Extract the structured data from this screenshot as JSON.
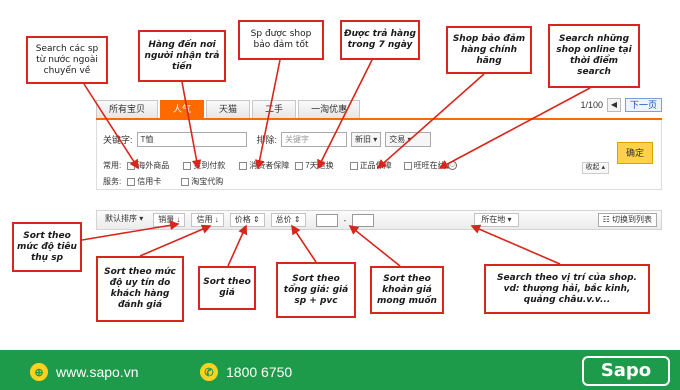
{
  "annotations": {
    "search_overseas": "Search các sp từ nước ngoài chuyển về",
    "cod": "Hàng đến nơi người nhận trả tiền",
    "guarantee": "Sp được shop bảo đảm tốt",
    "return7": "Được trả hàng trong 7 ngày",
    "authentic": "Shop bảo đảm hàng chính hãng",
    "online": "Search những shop online tại thời điểm search",
    "sort_volume": "Sort theo mức độ tiêu thụ sp",
    "sort_credit": "Sort theo mức độ uy tín do khách hàng đánh giá",
    "sort_price": "Sort theo giá",
    "sort_total": "Sort theo tổng giá: giá sp + pvc",
    "price_range": "Sort theo khoản giá mong muốn",
    "location": "Search theo vị trí của shop. vd: thượng hải, bắc kinh, quảng châu.v.v..."
  },
  "tabs": [
    "所有宝贝",
    "人气",
    "天猫",
    "二手",
    "一淘优惠"
  ],
  "pager": {
    "count": "1/100",
    "next": "下一页"
  },
  "filter": {
    "keyword_label": "关键字:",
    "keyword_value": "T恤",
    "exclude_label": "排除:",
    "exclude_placeholder": "关键字",
    "new_label": "新旧",
    "trade_label": "交易",
    "common_label": "常用:",
    "options": [
      "海外商品",
      "货到付款",
      "消费者保障",
      "7天退换",
      "正品保障",
      "旺旺在线"
    ],
    "service_label": "服务:",
    "service_options": [
      "信用卡",
      "淘宝代购"
    ],
    "fold_label": "收起",
    "confirm": "确定"
  },
  "sortbar": {
    "default": "默认排序",
    "volume": "销量",
    "credit": "信用",
    "price": "价格",
    "total": "总价",
    "location": "所在地",
    "list": "切换到列表"
  },
  "footer": {
    "website": "www.sapo.vn",
    "phone": "1800 6750",
    "logo": "Sapo"
  },
  "colors": {
    "annotation_border": "#d9261c",
    "tab_active": "#ff6a00",
    "footer_bg": "#1e9a4b"
  }
}
